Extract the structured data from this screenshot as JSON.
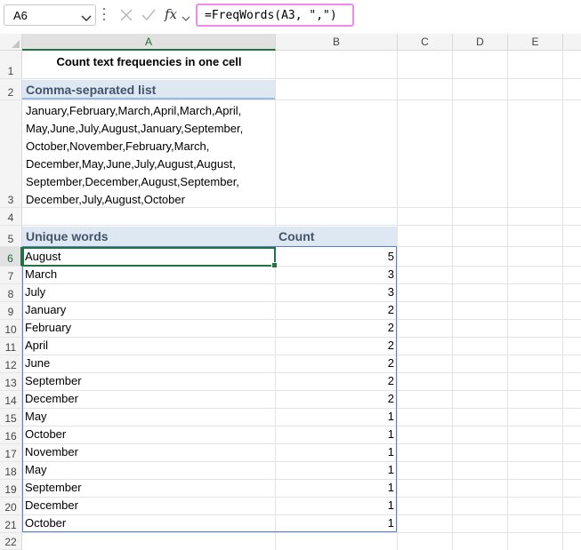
{
  "formula_bar": {
    "name_box": "A6",
    "formula": "=FreqWords(A3, \",\")"
  },
  "columns": [
    "A",
    "B",
    "C",
    "D",
    "E"
  ],
  "rows": [
    "1",
    "2",
    "3",
    "4",
    "5",
    "6",
    "7",
    "8",
    "9",
    "10",
    "11",
    "12",
    "13",
    "14",
    "15",
    "16",
    "17",
    "18",
    "19",
    "20",
    "21",
    "22"
  ],
  "sheet": {
    "title": "Count text frequencies in one cell",
    "list_header": "Comma-separated list",
    "list_lines": [
      "January,February,March,April,March,April,",
      "May,June,July,August,January,September,",
      "October,November,February,March,",
      "December,May,June,July,August,August,",
      "September,December,August,September,",
      "December,July,August,October"
    ],
    "table_headers": {
      "word": "Unique words",
      "count": "Count"
    },
    "table_rows": [
      {
        "word": "August",
        "count": "5"
      },
      {
        "word": "March",
        "count": "3"
      },
      {
        "word": "July",
        "count": "3"
      },
      {
        "word": "January",
        "count": "2"
      },
      {
        "word": "February",
        "count": "2"
      },
      {
        "word": "April",
        "count": "2"
      },
      {
        "word": "June",
        "count": "2"
      },
      {
        "word": "September",
        "count": "2"
      },
      {
        "word": "December",
        "count": "2"
      },
      {
        "word": "May",
        "count": "1"
      },
      {
        "word": "October",
        "count": "1"
      },
      {
        "word": "November",
        "count": "1"
      },
      {
        "word": "May",
        "count": "1"
      },
      {
        "word": "September",
        "count": "1"
      },
      {
        "word": "December",
        "count": "1"
      },
      {
        "word": "October",
        "count": "1"
      }
    ]
  },
  "icons": {
    "name_box_dropdown": "chevron-down-icon",
    "cancel": "close-icon",
    "enter": "check-icon",
    "insert_function": "fx-icon",
    "fx_dropdown": "chevron-down-icon"
  },
  "colors": {
    "accent": "#217346",
    "header_fill": "#dde8f3",
    "header_text": "#44546a",
    "table_border": "#5b7fc9",
    "formula_highlight": "#f28be8"
  }
}
